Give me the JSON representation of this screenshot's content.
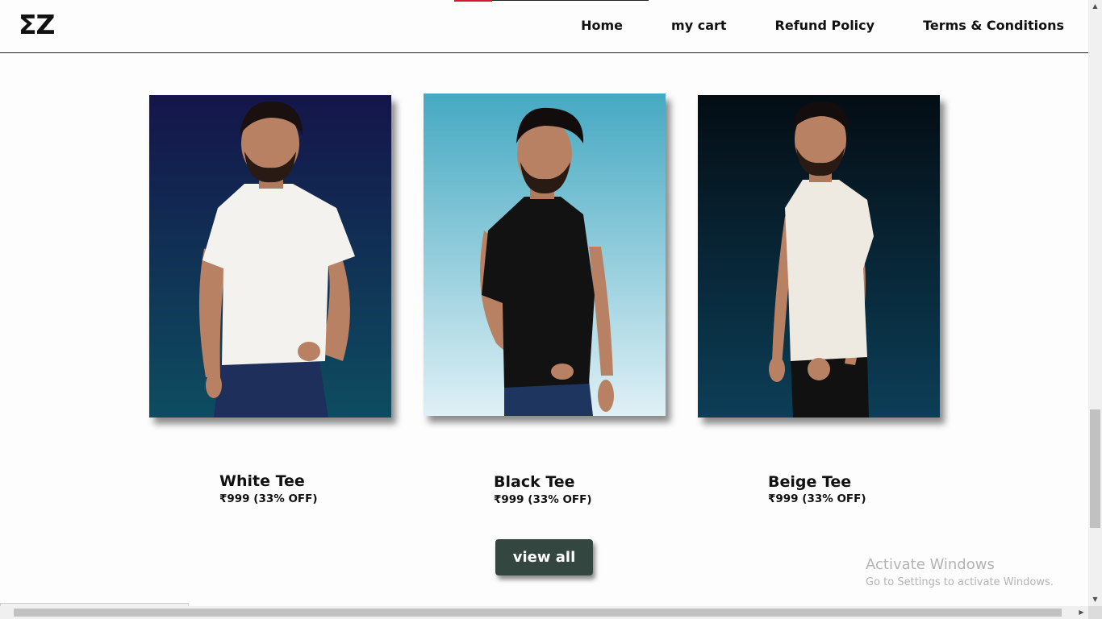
{
  "header": {
    "logo": "ΣZ",
    "nav": [
      "Home",
      "my cart",
      "Refund Policy",
      "Terms & Conditions"
    ]
  },
  "products": [
    {
      "name": "White Tee",
      "price": "₹999 (33% OFF)",
      "shirt_color": "#f4f2ef",
      "bg_top": "#14154a",
      "bg_bottom": "#0d4d60"
    },
    {
      "name": "Black Tee",
      "price": "₹999 (33% OFF)",
      "shirt_color": "#121212",
      "bg_top": "#45a9c2",
      "bg_bottom": "#dff0f5"
    },
    {
      "name": "Beige Tee",
      "price": "₹999 (33% OFF)",
      "shirt_color": "#efeae1",
      "bg_top": "#040d14",
      "bg_bottom": "#0c3e57"
    }
  ],
  "view_all_label": "view all",
  "watermark": {
    "title": "Activate Windows",
    "subtitle": "Go to Settings to activate Windows."
  },
  "status_url": "https://tanishtirpathi.github.io/EZwears/",
  "colors": {
    "button_bg": "#344640",
    "accent_red": "#d11a2a"
  }
}
